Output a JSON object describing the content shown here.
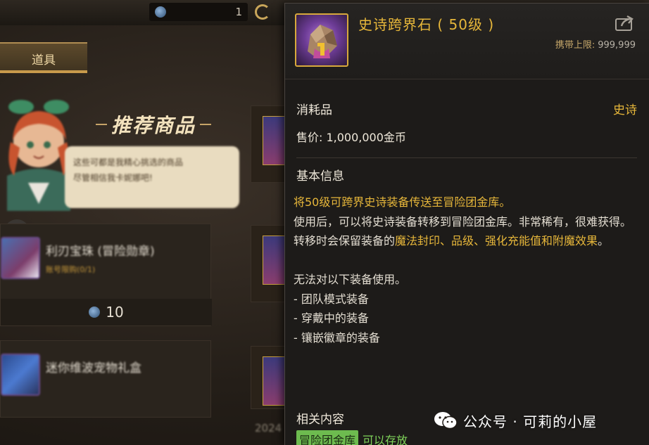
{
  "background": {
    "currency_count": "1",
    "tab_label": "道具",
    "recommend_title": "推荐商品",
    "npc_speech": [
      "这些可都是我精心挑选的商品",
      "尽管相信我卡妮娜吧!"
    ],
    "item1": {
      "name": "利刃宝珠 (冒险勋章)",
      "sub": "账号限购(0/1)",
      "price": "10"
    },
    "item2": {
      "name": "迷你维波宠物礼盒"
    },
    "year_text": "2024"
  },
  "tooltip": {
    "item_name": "史诗跨界石 ( 50级 )",
    "carry_limit_label": "携带上限:",
    "carry_limit_value": "999,999",
    "type": "消耗品",
    "rarity": "史诗",
    "price": "售价: 1,000,000金币",
    "section_basic": "基本信息",
    "desc_line1": "将50级可跨界史诗装备传送至冒险团金库。",
    "desc_line2": "使用后，可以将史诗装备转移到冒险团金库。非常稀有，很难获得。",
    "desc_line3_a": "转移时会保留装备的",
    "desc_line3_b": "魔法封印、品级、强化充能值和附魔效果",
    "desc_line3_c": "。",
    "desc_line4": "无法对以下装备使用。",
    "desc_line5": "- 团队模式装备",
    "desc_line6": "- 穿戴中的装备",
    "desc_line7": "- 镶嵌徽章的装备",
    "section_related": "相关内容",
    "storage_tag": "冒险团金库",
    "storage_ok": "可以存放"
  },
  "watermark": {
    "text": "公众号 · 可莉的小屋"
  },
  "colors": {
    "epic_gold": "#e7b73a",
    "storage_green": "#6dbb4f",
    "panel_bg": "#1d1b19"
  },
  "icons": [
    "coin-icon",
    "share-icon",
    "chevron-left-icon",
    "epic-stone-icon",
    "wechat-icon"
  ]
}
